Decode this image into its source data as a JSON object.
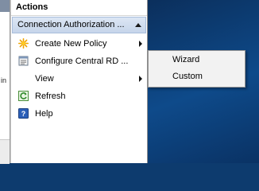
{
  "actions_pane": {
    "title": "Actions",
    "group_header": "Connection Authorization ...",
    "items": [
      {
        "label": "Create New Policy",
        "icon": "star-burst-icon",
        "has_submenu": true
      },
      {
        "label": "Configure Central RD ...",
        "icon": "properties-icon",
        "has_submenu": false
      },
      {
        "label": "View",
        "icon": "",
        "has_submenu": true
      },
      {
        "label": "Refresh",
        "icon": "refresh-icon",
        "has_submenu": false
      },
      {
        "label": "Help",
        "icon": "help-icon",
        "has_submenu": false
      }
    ]
  },
  "left_pane": {
    "truncated_text": "in"
  },
  "submenu": {
    "items": [
      {
        "label": "Wizard"
      },
      {
        "label": "Custom"
      }
    ]
  },
  "colors": {
    "desktop_blue": "#0e4a8a",
    "group_header_bg": "#c6d5ea",
    "menu_bg": "#f2f2f2"
  }
}
